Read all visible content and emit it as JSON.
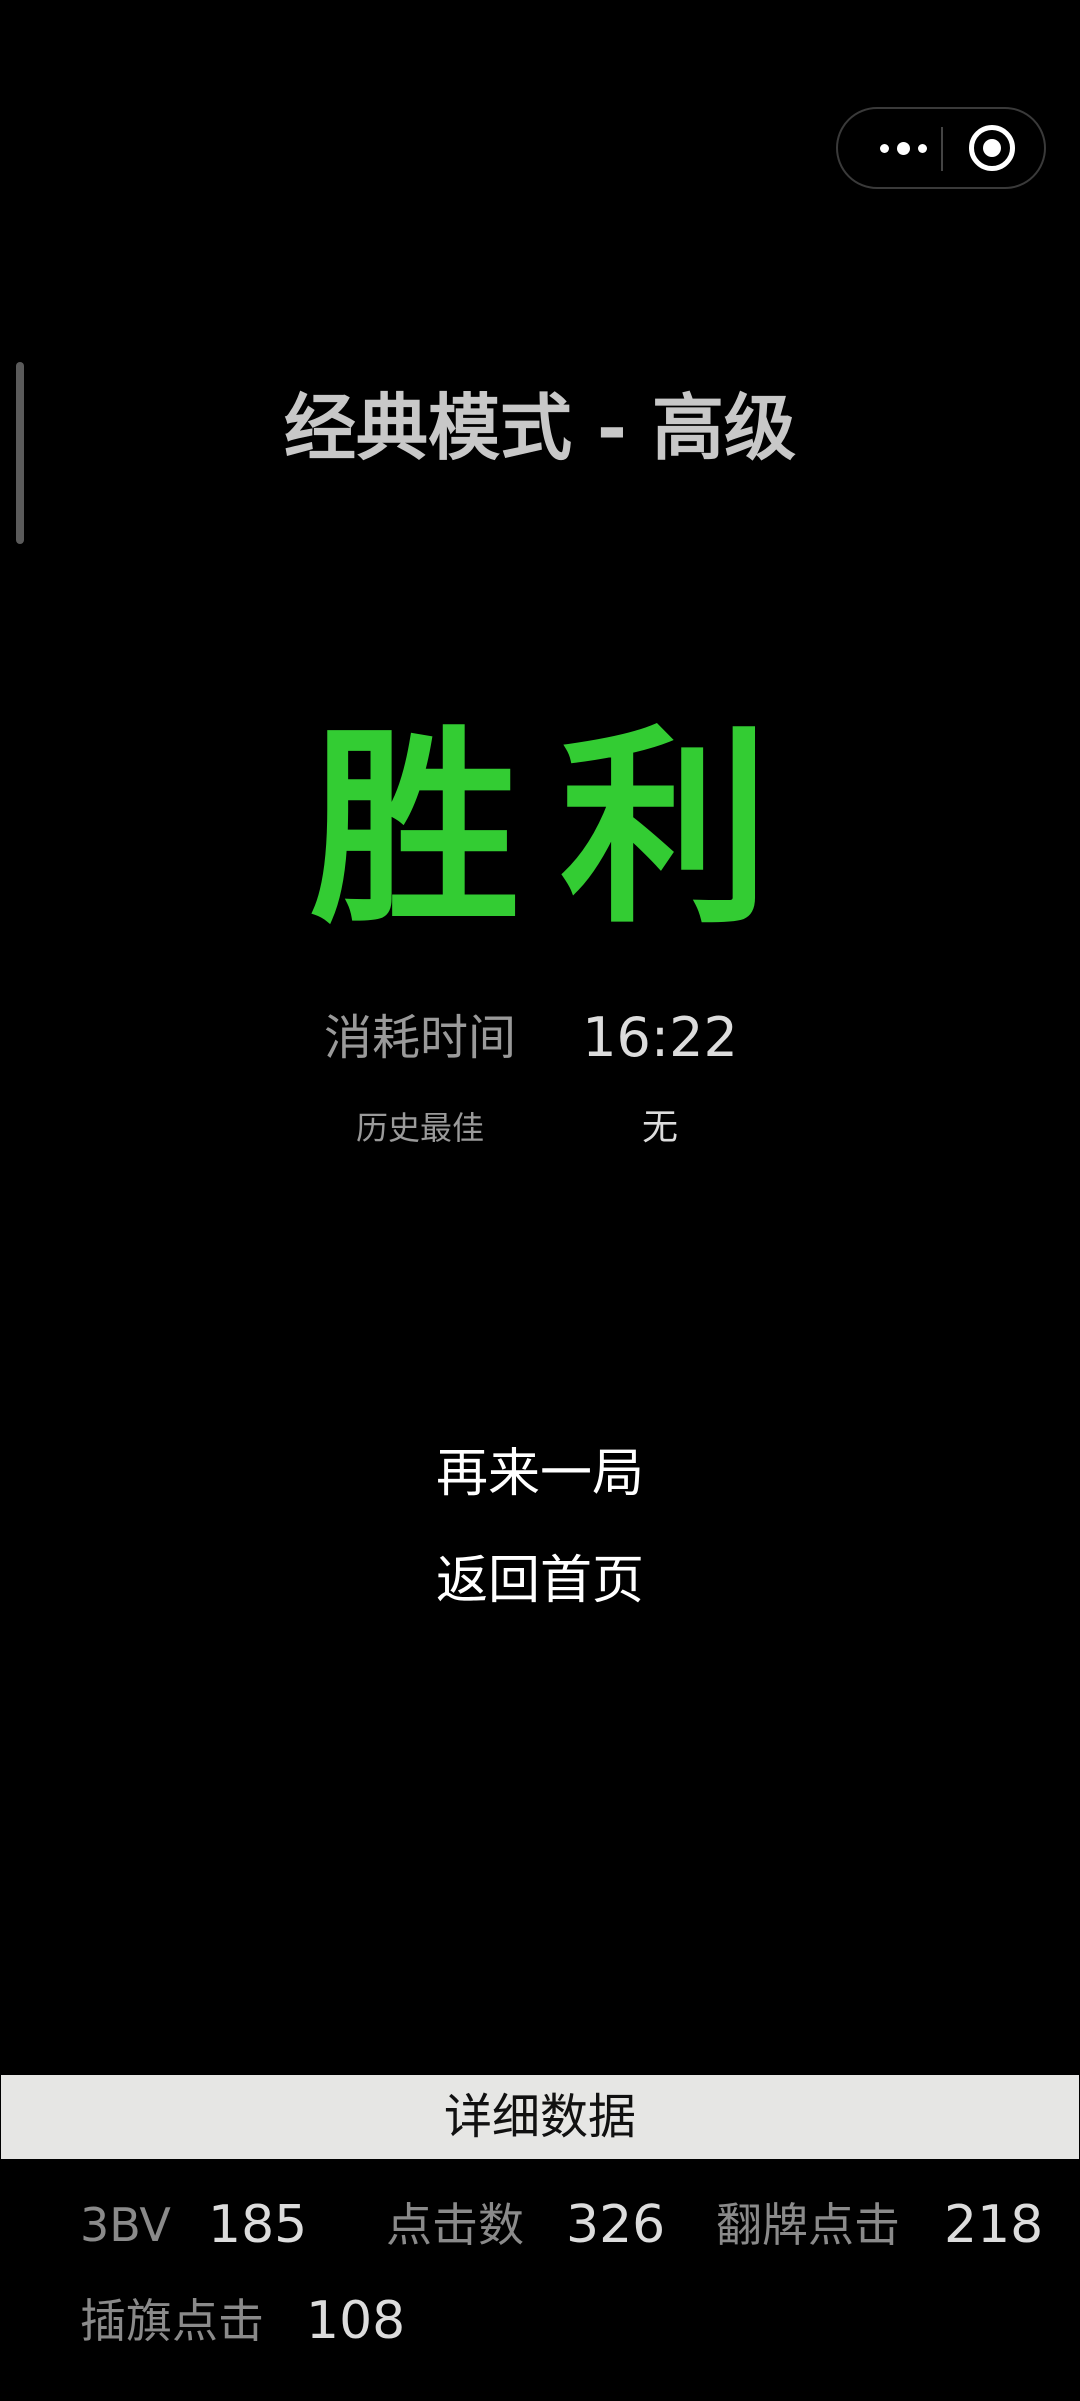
{
  "header": {
    "mode_title": "经典模式 - 高级"
  },
  "result": {
    "text": "胜利",
    "color": "#33cc33"
  },
  "stats": {
    "time_label": "消耗时间",
    "time_value": "16:22",
    "best_label": "历史最佳",
    "best_value": "无"
  },
  "actions": {
    "play_again": "再来一局",
    "back_home": "返回首页"
  },
  "details": {
    "header": "详细数据",
    "bv_label": "3BV",
    "bv_value": "185",
    "clicks_label": "点击数",
    "clicks_value": "326",
    "open_clicks_label": "翻牌点击",
    "open_clicks_value": "218",
    "flag_clicks_label": "插旗点击",
    "flag_clicks_value": "108"
  },
  "icons": {
    "capsule_more": "more-icon",
    "capsule_close": "close-target-icon"
  }
}
